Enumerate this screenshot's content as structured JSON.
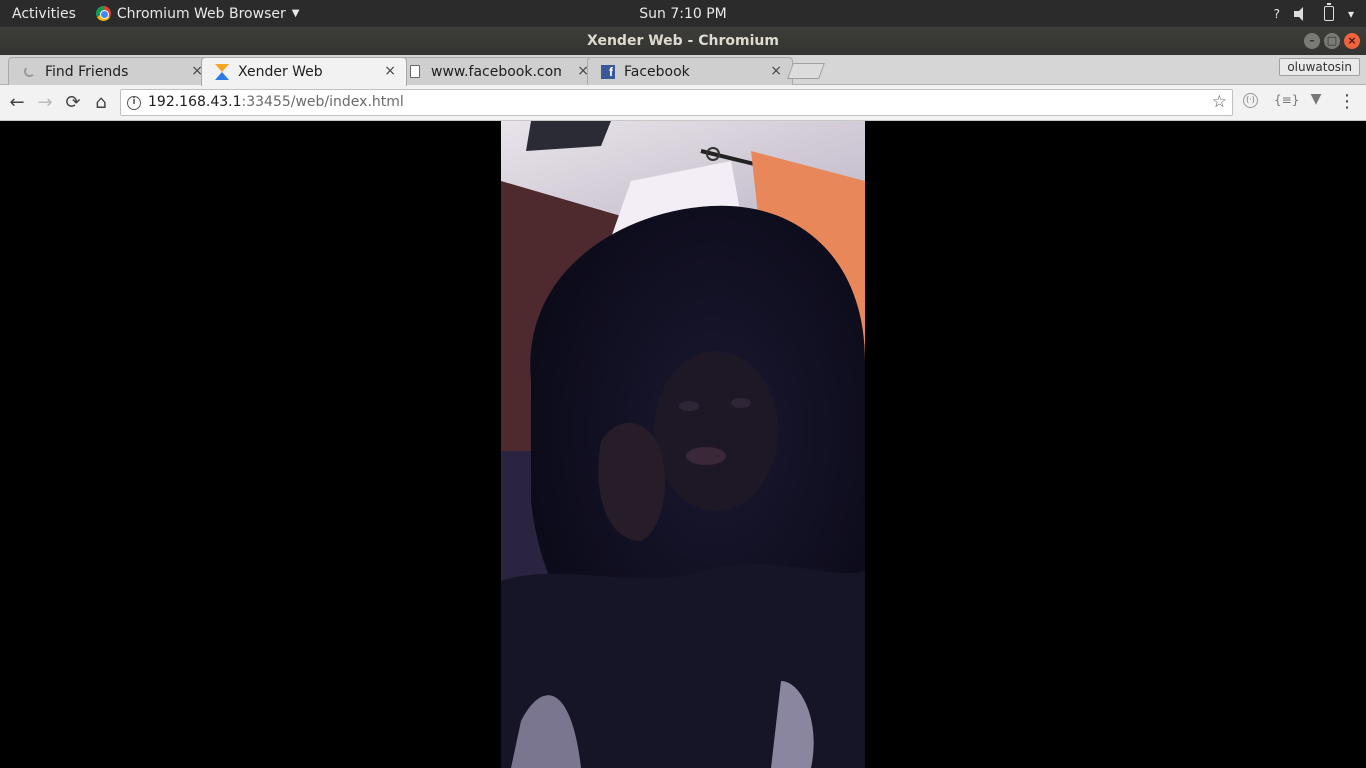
{
  "top_bar": {
    "activities": "Activities",
    "app_menu": "Chromium Web Browser",
    "clock": "Sun  7:10 PM",
    "tray": {
      "help": "?",
      "volume_icon": "speaker-icon",
      "battery_icon": "battery-icon",
      "menu_caret": "▾"
    }
  },
  "window": {
    "title": "Xender Web - Chromium",
    "controls": {
      "minimize": "–",
      "maximize": "□",
      "close": "×"
    }
  },
  "tabs": [
    {
      "title": "Find Friends",
      "icon": "spinner-icon",
      "close": "×",
      "active": false
    },
    {
      "title": "Xender Web",
      "icon": "xender-icon",
      "close": "×",
      "active": true
    },
    {
      "title": "www.facebook.com",
      "icon": "page-icon",
      "close": "×",
      "active": false
    },
    {
      "title": "Facebook",
      "icon": "facebook-icon",
      "close": "×",
      "active": false
    }
  ],
  "profile": {
    "name": "oluwatosin"
  },
  "toolbar": {
    "back": "←",
    "forward": "→",
    "reload": "⟳",
    "home": "⌂",
    "url_host": "192.168.43.1",
    "url_rest": ":33455/web/index.html",
    "bookmark_icon": "☆",
    "ext1": "(·)",
    "ext2": "{≡}",
    "ext3": "▼",
    "menu": "⋮"
  },
  "content": {
    "background": "#000000",
    "media": "photo"
  }
}
